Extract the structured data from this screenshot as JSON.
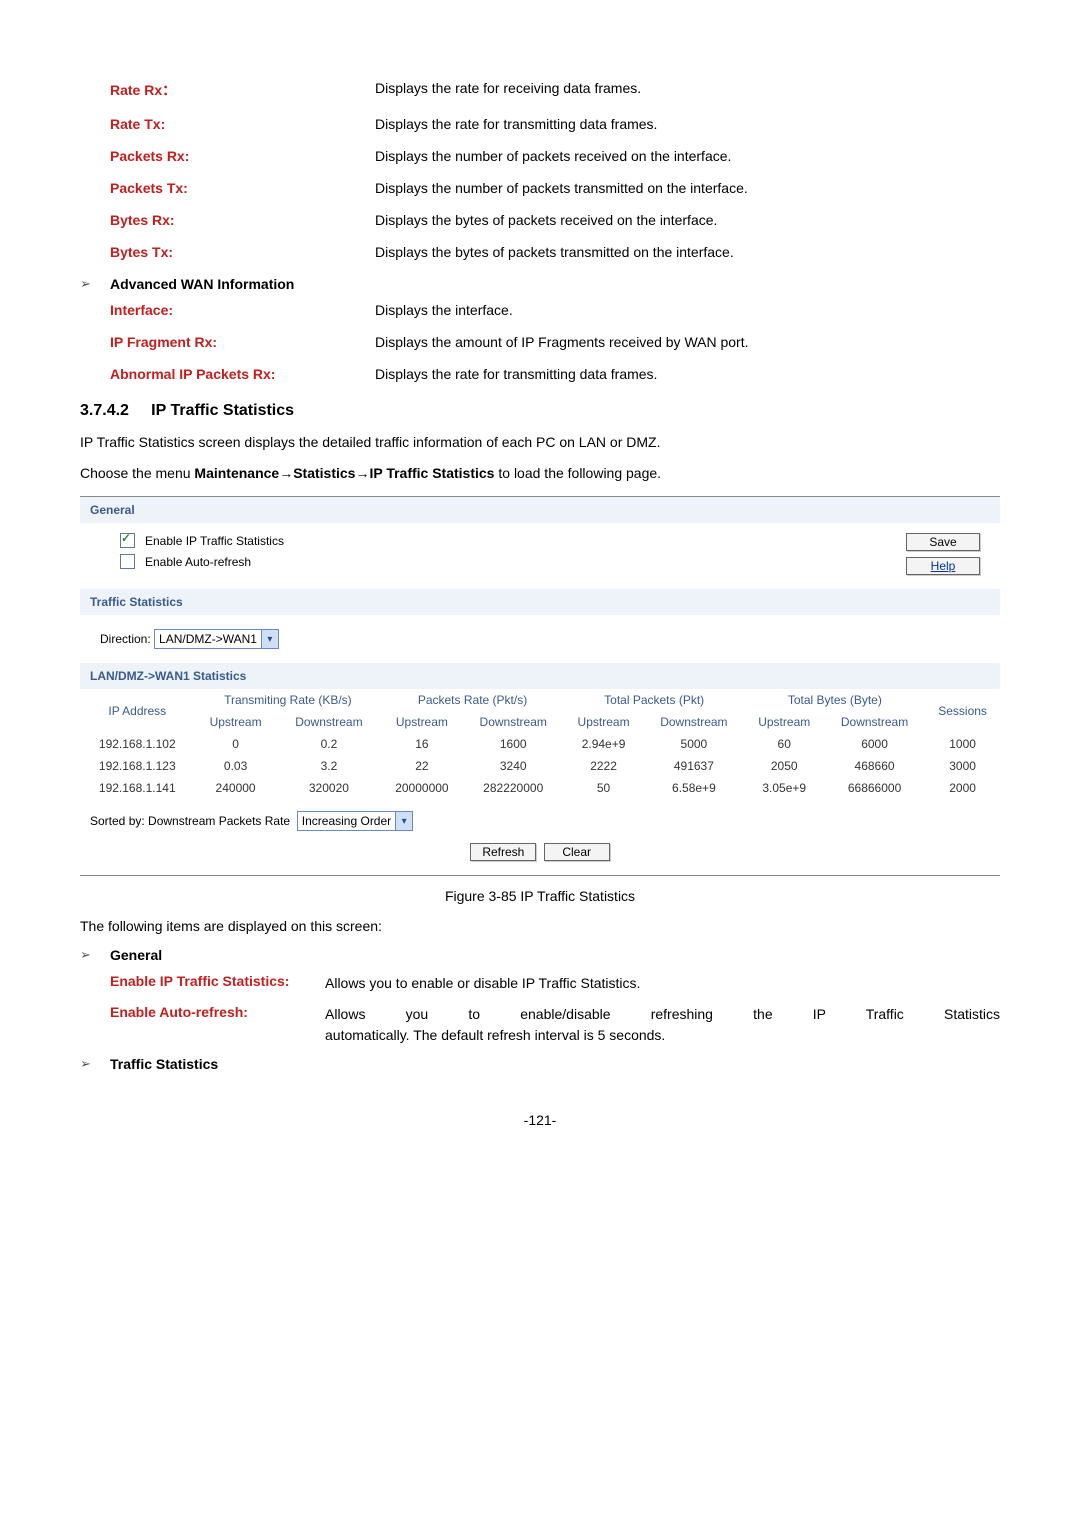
{
  "defs_top": [
    {
      "label": "Rate Rx：",
      "desc": "Displays the rate for receiving data frames."
    },
    {
      "label": "Rate Tx:",
      "desc": "Displays the rate for transmitting data frames."
    },
    {
      "label": "Packets Rx:",
      "desc": "Displays the number of packets received on the interface."
    },
    {
      "label": "Packets Tx:",
      "desc": "Displays the number of packets transmitted on the interface."
    },
    {
      "label": "Bytes Rx:",
      "desc": "Displays the bytes of packets received on the interface."
    },
    {
      "label": "Bytes Tx:",
      "desc": "Displays the bytes of packets transmitted on the interface."
    }
  ],
  "adv_wan_heading": "Advanced WAN Information",
  "defs_adv": [
    {
      "label": "Interface:",
      "desc": "Displays the interface."
    },
    {
      "label": "IP Fragment Rx:",
      "desc": "Displays the amount of IP Fragments received by WAN port."
    },
    {
      "label": "Abnormal IP Packets Rx:",
      "desc": "Displays the rate for transmitting data frames."
    }
  ],
  "h3_num": "3.7.4.2",
  "h3_title": "IP Traffic Statistics",
  "para1": "IP Traffic Statistics screen displays the detailed traffic information of each PC on LAN or DMZ.",
  "para2_a": "Choose the menu ",
  "para2_b": "Maintenance→Statistics→IP Traffic Statistics",
  "para2_c": " to load the following page.",
  "ss": {
    "band_general": "General",
    "chk1": "Enable IP Traffic Statistics",
    "chk2": "Enable Auto-refresh",
    "btn_save": "Save",
    "btn_help": "Help",
    "band_traffic": "Traffic Statistics",
    "dir_label": "Direction:",
    "dir_value": "LAN/DMZ->WAN1",
    "band_stats": "LAN/DMZ->WAN1 Statistics",
    "hdr_ip": "IP Address",
    "grp1": "Transmiting Rate (KB/s)",
    "grp2": "Packets Rate (Pkt/s)",
    "grp3": "Total Packets (Pkt)",
    "grp4": "Total Bytes (Byte)",
    "hdr_sess": "Sessions",
    "sub_up": "Upstream",
    "sub_down": "Downstream",
    "rows": [
      {
        "ip": "192.168.1.102",
        "tu": "0",
        "td": "0.2",
        "pu": "16",
        "pd": "1600",
        "tpu": "2.94e+9",
        "tpd": "5000",
        "bu": "60",
        "bd": "6000",
        "s": "1000"
      },
      {
        "ip": "192.168.1.123",
        "tu": "0.03",
        "td": "3.2",
        "pu": "22",
        "pd": "3240",
        "tpu": "2222",
        "tpd": "491637",
        "bu": "2050",
        "bd": "468660",
        "s": "3000"
      },
      {
        "ip": "192.168.1.141",
        "tu": "240000",
        "td": "320020",
        "pu": "20000000",
        "pd": "282220000",
        "tpu": "50",
        "tpd": "6.58e+9",
        "bu": "3.05e+9",
        "bd": "66866000",
        "s": "2000"
      }
    ],
    "sorted_by_label": "Sorted by:",
    "sorted_by_value": "Downstream Packets Rate",
    "order_value": "Increasing Order",
    "btn_refresh": "Refresh",
    "btn_clear": "Clear"
  },
  "fig_caption": "Figure 3-85 IP Traffic Statistics",
  "para3": "The following items are displayed on this screen:",
  "gen_heading": "General",
  "gen_defs": [
    {
      "label": "Enable IP Traffic Statistics:",
      "desc": "Allows you to enable or disable IP Traffic Statistics."
    },
    {
      "label": "Enable Auto-refresh:",
      "desc_line1": "Allows you to enable/disable refreshing the IP Traffic Statistics",
      "desc_line2": "automatically. The default refresh interval is 5 seconds."
    }
  ],
  "traffic_heading": "Traffic Statistics",
  "page_num": "-121-"
}
